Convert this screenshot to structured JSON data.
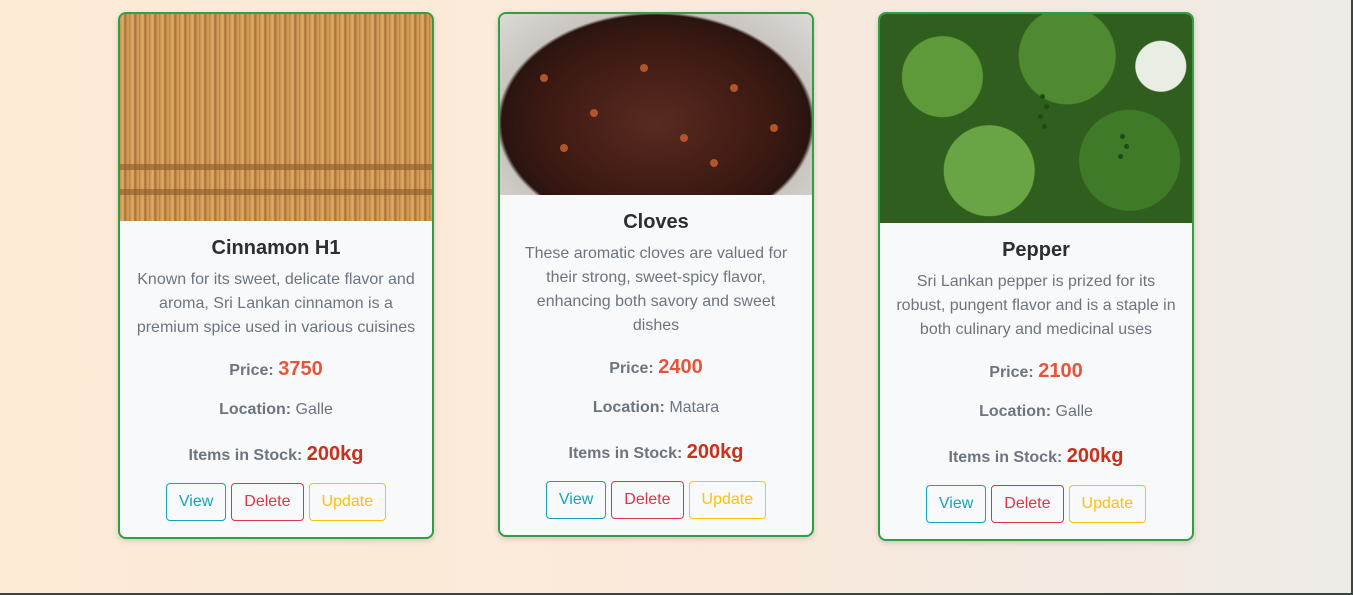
{
  "products": [
    {
      "title": "Cinnamon H1",
      "image_alt": "cinnamon-sticks-image",
      "description": "Known for its sweet, delicate flavor and aroma, Sri Lankan cinnamon is a premium spice used in various cuisines",
      "price_label": "Price:",
      "price": "3750",
      "location_label": "Location:",
      "location": "Galle",
      "stock_label": "Items in Stock:",
      "stock": "200kg",
      "view_label": "View",
      "delete_label": "Delete",
      "update_label": "Update"
    },
    {
      "title": "Cloves",
      "image_alt": "cloves-image",
      "description": "These aromatic cloves are valued for their strong, sweet-spicy flavor, enhancing both savory and sweet dishes",
      "price_label": "Price:",
      "price": "2400",
      "location_label": "Location:",
      "location": "Matara",
      "stock_label": "Items in Stock:",
      "stock": "200kg",
      "view_label": "View",
      "delete_label": "Delete",
      "update_label": "Update"
    },
    {
      "title": "Pepper",
      "image_alt": "pepper-plant-image",
      "description": "Sri Lankan pepper is prized for its robust, pungent flavor and is a staple in both culinary and medicinal uses",
      "price_label": "Price:",
      "price": "2100",
      "location_label": "Location:",
      "location": "Galle",
      "stock_label": "Items in Stock:",
      "stock": "200kg",
      "view_label": "View",
      "delete_label": "Delete",
      "update_label": "Update"
    }
  ],
  "colors": {
    "card_border": "#2ea043",
    "price": "#e8543a",
    "stock": "#c8311c",
    "view": "#17a2b8",
    "delete": "#dc3545",
    "update": "#ffc107"
  }
}
